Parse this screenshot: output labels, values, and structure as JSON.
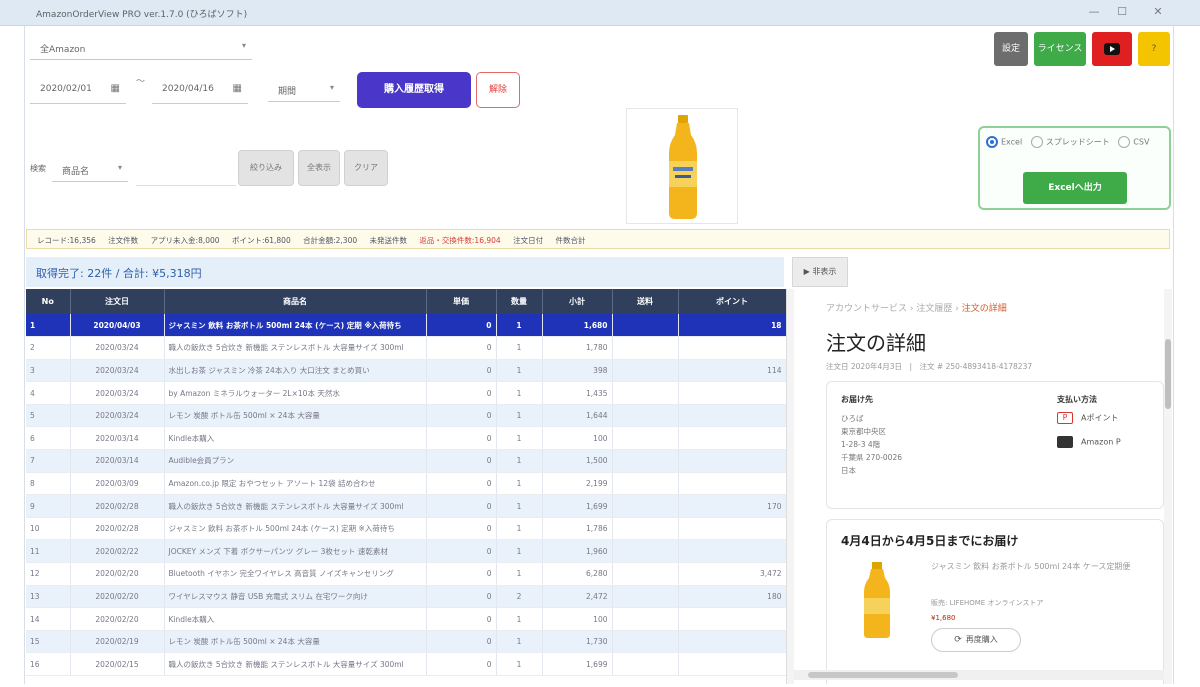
{
  "window": {
    "title": "AmazonOrderView PRO ver.1.7.0 (ひろばソフト)",
    "controls": [
      "—",
      "☐",
      "✕"
    ]
  },
  "toolbar": {
    "account_select": "全Amazon",
    "date_from": "2020/02/01",
    "date_to": "2020/04/16",
    "date_sep": "〜",
    "period_select": "期間",
    "fetch_button": "購入履歴取得",
    "reset_button": "解除",
    "settings_button": "設定",
    "license_button": "ライセンス",
    "help_button": "?"
  },
  "filter": {
    "label": "検索",
    "field_select": "商品名",
    "search_placeholder": "",
    "buttons": [
      "絞り込み",
      "全表示",
      "クリア"
    ]
  },
  "print_panel": {
    "options": [
      "Excel",
      "スプレッドシート",
      "CSV"
    ],
    "selected": "Excel",
    "output_button": "Excelへ出力"
  },
  "summary": {
    "items": [
      "レコード:16,356",
      "注文件数",
      "アプリ未入金:8,000",
      "ポイント:61,800",
      "合計金額:2,300",
      "未発送件数"
    ],
    "warning": "返品・交換件数:16,904",
    "tail": [
      "注文日付",
      "件数合計"
    ]
  },
  "status": {
    "text": "取得完了: 22件 / 合計: ¥5,318円"
  },
  "table": {
    "columns": [
      "No",
      "注文日",
      "商品名",
      "単価",
      "数量",
      "小計",
      "送料",
      "ポイント"
    ],
    "selected_row": 0,
    "rows": [
      [
        "1",
        "2020/04/03",
        "ジャスミン 飲料 お茶ボトル 500ml 24本 (ケース) 定期 ※入荷待ち",
        "0",
        "1",
        "1,680",
        "",
        "18"
      ],
      [
        "2",
        "2020/03/24",
        "職人の飯炊き 5合炊き 新機能 ステンレスボトル 大容量サイズ 300ml",
        "0",
        "1",
        "1,780",
        "",
        ""
      ],
      [
        "3",
        "2020/03/24",
        "水出しお茶 ジャスミン 冷茶 24本入り 大口注文 まとめ買い",
        "0",
        "1",
        "398",
        "",
        "114"
      ],
      [
        "4",
        "2020/03/24",
        "by Amazon ミネラルウォーター 2L×10本 天然水",
        "0",
        "1",
        "1,435",
        "",
        ""
      ],
      [
        "5",
        "2020/03/24",
        "レモン 炭酸 ボトル缶 500ml × 24本 大容量",
        "0",
        "1",
        "1,644",
        "",
        ""
      ],
      [
        "6",
        "2020/03/14",
        "Kindle本購入",
        "0",
        "1",
        "100",
        "",
        ""
      ],
      [
        "7",
        "2020/03/14",
        "Audible会員プラン",
        "0",
        "1",
        "1,500",
        "",
        ""
      ],
      [
        "8",
        "2020/03/09",
        "Amazon.co.jp 限定 おやつセット アソート 12袋 詰め合わせ",
        "0",
        "1",
        "2,199",
        "",
        ""
      ],
      [
        "9",
        "2020/02/28",
        "職人の飯炊き 5合炊き 新機能 ステンレスボトル 大容量サイズ 300ml",
        "0",
        "1",
        "1,699",
        "",
        "170"
      ],
      [
        "10",
        "2020/02/28",
        "ジャスミン 飲料 お茶ボトル 500ml 24本 (ケース) 定期 ※入荷待ち",
        "0",
        "1",
        "1,786",
        "",
        ""
      ],
      [
        "11",
        "2020/02/22",
        "JOCKEY メンズ 下着 ボクサーパンツ グレー 3枚セット 速乾素材",
        "0",
        "1",
        "1,960",
        "",
        ""
      ],
      [
        "12",
        "2020/02/20",
        "Bluetooth イヤホン 完全ワイヤレス 高音質 ノイズキャンセリング",
        "0",
        "1",
        "6,280",
        "",
        "3,472"
      ],
      [
        "13",
        "2020/02/20",
        "ワイヤレスマウス 静音 USB 充電式 スリム 在宅ワーク向け",
        "0",
        "2",
        "2,472",
        "",
        "180"
      ],
      [
        "14",
        "2020/02/20",
        "Kindle本購入",
        "0",
        "1",
        "100",
        "",
        ""
      ],
      [
        "15",
        "2020/02/19",
        "レモン 炭酸 ボトル缶 500ml × 24本 大容量",
        "0",
        "1",
        "1,730",
        "",
        ""
      ],
      [
        "16",
        "2020/02/15",
        "職人の飯炊き 5合炊き 新機能 ステンレスボトル 大容量サイズ 300ml",
        "0",
        "1",
        "1,699",
        "",
        ""
      ]
    ]
  },
  "detail": {
    "tab_label": "▶ 非表示",
    "breadcrumb": [
      "アカウントサービス",
      "注文履歴",
      "注文の詳細"
    ],
    "breadcrumb_sep": "›",
    "title": "注文の詳細",
    "meta": "注文日 2020年4月3日　|　注文 # 250-4893418-4178237",
    "address_heading": "お届け先",
    "address_lines": [
      "ひろば",
      "東京都中央区",
      "1-28-3 4階",
      "千葉県 270-0026",
      "日本"
    ],
    "payment_heading": "支払い方法",
    "payment_rows": [
      "Aポイント",
      "Amazon P"
    ],
    "delivery_heading": "4月4日から4月5日までにお届け",
    "item_name": "ジャスミン 飲料 お茶ボトル 500ml 24本 ケース定期便",
    "item_seller": "販売: LIFEHOME オンラインストア",
    "item_price": "¥1,680",
    "rebuy_button": "再度購入"
  },
  "colors": {
    "primary": "#4a36c9",
    "selected_row": "#1f33b8",
    "header": "#2f3f5c",
    "green": "#3eaa48",
    "youtube": "#e02020",
    "yellow": "#f5c400"
  }
}
